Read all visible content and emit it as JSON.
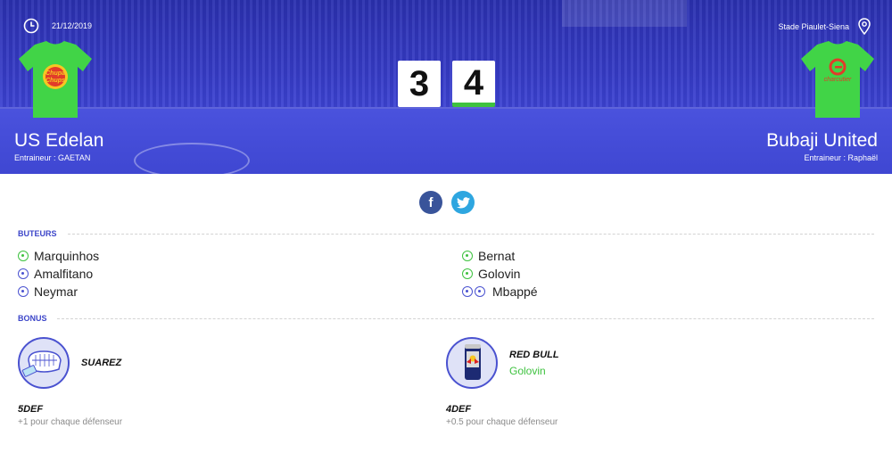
{
  "match": {
    "date": "21/12/2019",
    "stadium": "Stade Piaulet-Siena",
    "home": {
      "name": "US Edelan",
      "coach": "Entraineur : GAETAN",
      "score": "3",
      "sponsor": "Chupa Chups"
    },
    "away": {
      "name": "Bubaji United",
      "coach": "Entraineur : Raphaël",
      "score": "4",
      "sponsor": "Charcutier"
    }
  },
  "share": {
    "facebook": "f",
    "twitter": "t"
  },
  "sections": {
    "scorers_title": "BUTEURS",
    "bonus_title": "BONUS"
  },
  "scorers": {
    "home": [
      {
        "name": "Marquinhos",
        "ball": "green",
        "count": 1
      },
      {
        "name": "Amalfitano",
        "ball": "blue",
        "count": 1
      },
      {
        "name": "Neymar",
        "ball": "blue",
        "count": 1
      }
    ],
    "away": [
      {
        "name": "Bernat",
        "ball": "green",
        "count": 1
      },
      {
        "name": "Golovin",
        "ball": "green",
        "count": 1
      },
      {
        "name": "Mbappé",
        "ball": "blue",
        "count": 2
      }
    ]
  },
  "bonus": {
    "home": {
      "name": "SUAREZ",
      "player": "",
      "icon": "teeth-icon",
      "code": "5DEF",
      "description": "+1 pour chaque défenseur"
    },
    "away": {
      "name": "RED BULL",
      "player": "Golovin",
      "icon": "energy-drink-icon",
      "code": "4DEF",
      "description": "+0.5 pour chaque défenseur"
    }
  },
  "colors": {
    "hero": "#3f47d8",
    "accent_green": "#3ec23f",
    "accent_blue": "#3d46c9",
    "jersey": "#41d447"
  }
}
